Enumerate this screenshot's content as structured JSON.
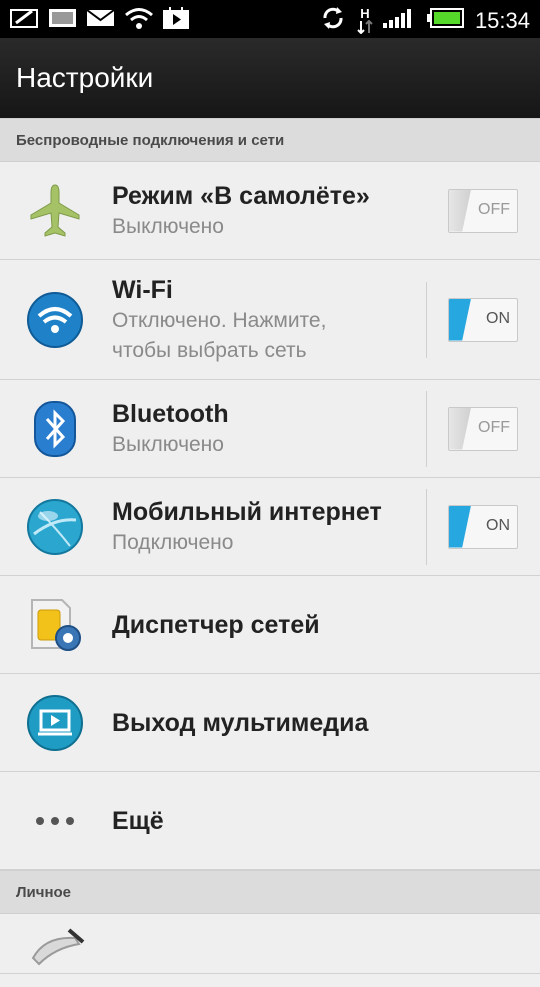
{
  "status_bar": {
    "time": "15:34",
    "network_letter": "H"
  },
  "action_bar": {
    "title": "Настройки"
  },
  "sections": {
    "wireless": {
      "header": "Беспроводные подключения и сети"
    },
    "personal": {
      "header": "Личное"
    }
  },
  "items": {
    "airplane": {
      "title": "Режим «В самолёте»",
      "summary": "Выключено",
      "toggle": "OFF"
    },
    "wifi": {
      "title": "Wi-Fi",
      "summary_line1": "Отключено. Нажмите,",
      "summary_line2": "чтобы выбрать сеть",
      "toggle": "ON"
    },
    "bluetooth": {
      "title": "Bluetooth",
      "summary": "Выключено",
      "toggle": "OFF"
    },
    "mobile": {
      "title": "Мобильный интернет",
      "summary": "Подключено",
      "toggle": "ON"
    },
    "netmgr": {
      "title": "Диспетчер сетей"
    },
    "media": {
      "title": "Выход мультимедиа"
    },
    "more": {
      "title": "Ещё"
    }
  },
  "colors": {
    "accent": "#27a7df",
    "battery": "#55d82a"
  }
}
